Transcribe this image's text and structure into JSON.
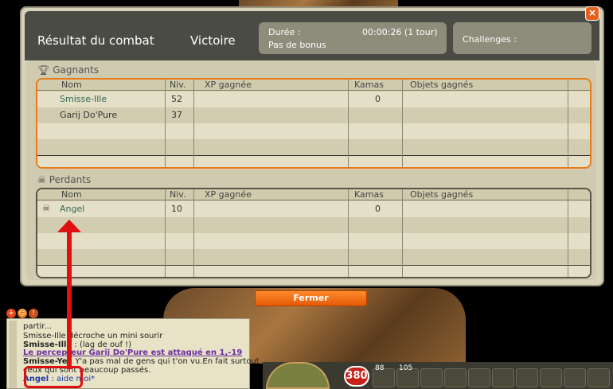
{
  "window": {
    "title": "Résultat du combat",
    "outcome": "Victoire",
    "duration_label": "Durée :",
    "duration_value": "00:00:26 (1 tour)",
    "bonus_label": "Pas de bonus",
    "challenges_label": "Challenges :",
    "close_symbol": "×"
  },
  "columns": [
    "Nom",
    "Niv.",
    "XP gagnée",
    "Kamas",
    "Objets gagnés"
  ],
  "winners": {
    "label": "Gagnants",
    "icon": "trophy-icon",
    "rows": [
      {
        "name": "Smisse-Ille",
        "level": "52",
        "xp": "",
        "kamas": "0",
        "items": ""
      },
      {
        "name": "Garij Do'Pure",
        "level": "37",
        "xp": "",
        "kamas": "",
        "items": ""
      }
    ]
  },
  "losers": {
    "label": "Perdants",
    "icon": "skull-icon",
    "rows": [
      {
        "name": "Angel",
        "level": "10",
        "xp": "",
        "kamas": "0",
        "items": ""
      }
    ]
  },
  "buttons": {
    "close_label": "Fermer"
  },
  "chat": {
    "lines": [
      {
        "text": "partir..."
      },
      {
        "text": "Smisse-Ille décroche un mini sourir"
      },
      {
        "speaker": "Smisse-Ille",
        "text": " : (lag de ouf !)"
      },
      {
        "text": "Le percepteur Garij Do'Pure est attaqué en 1,-19"
      },
      {
        "speaker": "Smisse-Ye",
        "text": " : Y'a pas mal de gens qui t'on vu.En fait surtout"
      },
      {
        "text": "ceux qui sont beaucoup passés."
      },
      {
        "speaker": "Angel",
        "text": " : aide moi*"
      }
    ]
  },
  "hud": {
    "hp": "380",
    "stat1": "88",
    "stat2": "105"
  },
  "colors": {
    "accent_orange": "#e87a1a",
    "annotation_red": "#e01010",
    "title_bar": "#4b4b45"
  }
}
